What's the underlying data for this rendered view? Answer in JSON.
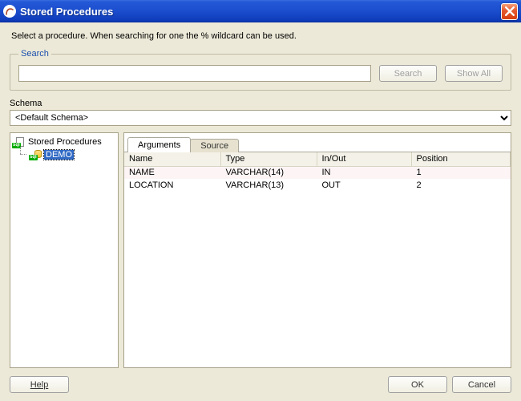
{
  "window": {
    "title": "Stored Procedures"
  },
  "instructions": "Select a procedure. When searching for one the % wildcard can be used.",
  "search": {
    "legend": "Search",
    "value": "",
    "placeholder": "",
    "search_btn": "Search",
    "showall_btn": "Show All"
  },
  "schema": {
    "label": "Schema",
    "selected": "<Default Schema>",
    "options": [
      "<Default Schema>"
    ]
  },
  "tree": {
    "root_label": "Stored Procedures",
    "items": [
      {
        "label": "DEMO",
        "selected": true
      }
    ]
  },
  "tabs": {
    "items": [
      {
        "id": "arguments",
        "label": "Arguments",
        "active": true
      },
      {
        "id": "source",
        "label": "Source",
        "active": false
      }
    ]
  },
  "args_table": {
    "headers": {
      "name": "Name",
      "type": "Type",
      "inout": "In/Out",
      "position": "Position"
    },
    "rows": [
      {
        "name": "NAME",
        "type": "VARCHAR(14)",
        "inout": "IN",
        "position": "1"
      },
      {
        "name": "LOCATION",
        "type": "VARCHAR(13)",
        "inout": "OUT",
        "position": "2"
      }
    ]
  },
  "footer": {
    "help": "Help",
    "ok": "OK",
    "cancel": "Cancel"
  }
}
